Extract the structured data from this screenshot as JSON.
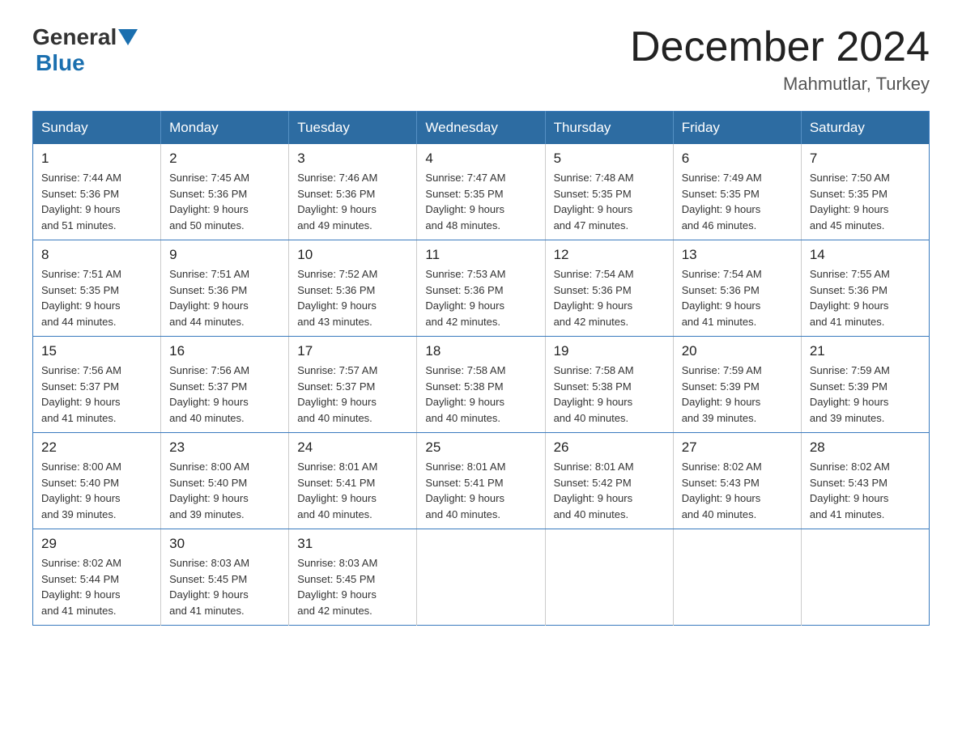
{
  "header": {
    "logo_general": "General",
    "logo_blue": "Blue",
    "month_title": "December 2024",
    "location": "Mahmutlar, Turkey"
  },
  "calendar": {
    "days_of_week": [
      "Sunday",
      "Monday",
      "Tuesday",
      "Wednesday",
      "Thursday",
      "Friday",
      "Saturday"
    ],
    "weeks": [
      [
        {
          "day": "1",
          "sunrise": "7:44 AM",
          "sunset": "5:36 PM",
          "daylight": "9 hours and 51 minutes."
        },
        {
          "day": "2",
          "sunrise": "7:45 AM",
          "sunset": "5:36 PM",
          "daylight": "9 hours and 50 minutes."
        },
        {
          "day": "3",
          "sunrise": "7:46 AM",
          "sunset": "5:36 PM",
          "daylight": "9 hours and 49 minutes."
        },
        {
          "day": "4",
          "sunrise": "7:47 AM",
          "sunset": "5:35 PM",
          "daylight": "9 hours and 48 minutes."
        },
        {
          "day": "5",
          "sunrise": "7:48 AM",
          "sunset": "5:35 PM",
          "daylight": "9 hours and 47 minutes."
        },
        {
          "day": "6",
          "sunrise": "7:49 AM",
          "sunset": "5:35 PM",
          "daylight": "9 hours and 46 minutes."
        },
        {
          "day": "7",
          "sunrise": "7:50 AM",
          "sunset": "5:35 PM",
          "daylight": "9 hours and 45 minutes."
        }
      ],
      [
        {
          "day": "8",
          "sunrise": "7:51 AM",
          "sunset": "5:35 PM",
          "daylight": "9 hours and 44 minutes."
        },
        {
          "day": "9",
          "sunrise": "7:51 AM",
          "sunset": "5:36 PM",
          "daylight": "9 hours and 44 minutes."
        },
        {
          "day": "10",
          "sunrise": "7:52 AM",
          "sunset": "5:36 PM",
          "daylight": "9 hours and 43 minutes."
        },
        {
          "day": "11",
          "sunrise": "7:53 AM",
          "sunset": "5:36 PM",
          "daylight": "9 hours and 42 minutes."
        },
        {
          "day": "12",
          "sunrise": "7:54 AM",
          "sunset": "5:36 PM",
          "daylight": "9 hours and 42 minutes."
        },
        {
          "day": "13",
          "sunrise": "7:54 AM",
          "sunset": "5:36 PM",
          "daylight": "9 hours and 41 minutes."
        },
        {
          "day": "14",
          "sunrise": "7:55 AM",
          "sunset": "5:36 PM",
          "daylight": "9 hours and 41 minutes."
        }
      ],
      [
        {
          "day": "15",
          "sunrise": "7:56 AM",
          "sunset": "5:37 PM",
          "daylight": "9 hours and 41 minutes."
        },
        {
          "day": "16",
          "sunrise": "7:56 AM",
          "sunset": "5:37 PM",
          "daylight": "9 hours and 40 minutes."
        },
        {
          "day": "17",
          "sunrise": "7:57 AM",
          "sunset": "5:37 PM",
          "daylight": "9 hours and 40 minutes."
        },
        {
          "day": "18",
          "sunrise": "7:58 AM",
          "sunset": "5:38 PM",
          "daylight": "9 hours and 40 minutes."
        },
        {
          "day": "19",
          "sunrise": "7:58 AM",
          "sunset": "5:38 PM",
          "daylight": "9 hours and 40 minutes."
        },
        {
          "day": "20",
          "sunrise": "7:59 AM",
          "sunset": "5:39 PM",
          "daylight": "9 hours and 39 minutes."
        },
        {
          "day": "21",
          "sunrise": "7:59 AM",
          "sunset": "5:39 PM",
          "daylight": "9 hours and 39 minutes."
        }
      ],
      [
        {
          "day": "22",
          "sunrise": "8:00 AM",
          "sunset": "5:40 PM",
          "daylight": "9 hours and 39 minutes."
        },
        {
          "day": "23",
          "sunrise": "8:00 AM",
          "sunset": "5:40 PM",
          "daylight": "9 hours and 39 minutes."
        },
        {
          "day": "24",
          "sunrise": "8:01 AM",
          "sunset": "5:41 PM",
          "daylight": "9 hours and 40 minutes."
        },
        {
          "day": "25",
          "sunrise": "8:01 AM",
          "sunset": "5:41 PM",
          "daylight": "9 hours and 40 minutes."
        },
        {
          "day": "26",
          "sunrise": "8:01 AM",
          "sunset": "5:42 PM",
          "daylight": "9 hours and 40 minutes."
        },
        {
          "day": "27",
          "sunrise": "8:02 AM",
          "sunset": "5:43 PM",
          "daylight": "9 hours and 40 minutes."
        },
        {
          "day": "28",
          "sunrise": "8:02 AM",
          "sunset": "5:43 PM",
          "daylight": "9 hours and 41 minutes."
        }
      ],
      [
        {
          "day": "29",
          "sunrise": "8:02 AM",
          "sunset": "5:44 PM",
          "daylight": "9 hours and 41 minutes."
        },
        {
          "day": "30",
          "sunrise": "8:03 AM",
          "sunset": "5:45 PM",
          "daylight": "9 hours and 41 minutes."
        },
        {
          "day": "31",
          "sunrise": "8:03 AM",
          "sunset": "5:45 PM",
          "daylight": "9 hours and 42 minutes."
        },
        null,
        null,
        null,
        null
      ]
    ]
  }
}
